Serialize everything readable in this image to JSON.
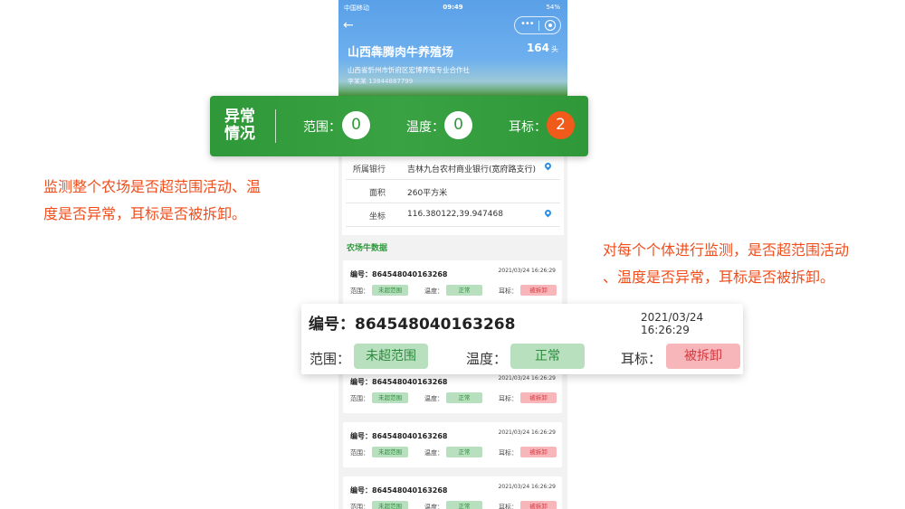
{
  "status_bar": {
    "carrier": "中国移动",
    "time": "09:49",
    "battery": "54%"
  },
  "header": {
    "farm_name": "山西犇腾肉牛养殖场",
    "head_count": "164",
    "head_unit": "头",
    "cooperative": "山西省忻州市忻府区宏博养殖专业合作社",
    "contact": "李某某   13844887799"
  },
  "abnormal": {
    "title": "异常情况",
    "range_label": "范围：",
    "range_value": "0",
    "temp_label": "温度：",
    "temp_value": "0",
    "tag_label": "耳标：",
    "tag_value": "2",
    "alert_color": "#f05a1a"
  },
  "info": [
    {
      "label": "所属银行",
      "value": "吉林九台农村商业银行(宽府路支行)",
      "icon": "location-pin-icon"
    },
    {
      "label": "面积",
      "value": "260平方米"
    },
    {
      "label": "坐标",
      "value": "116.380122,39.947468",
      "icon": "location-pin-icon"
    }
  ],
  "section_title": "农场牛数据",
  "labels": {
    "id": "编号：",
    "range": "范围：",
    "temp": "温度：",
    "tag": "耳标："
  },
  "records": [
    {
      "id": "864548040163268",
      "time": "2021/03/24 16:26:29",
      "range": "未超范围",
      "temp": "正常",
      "tag": "被拆卸"
    },
    {
      "id": "864548040163268",
      "time": "2021/03/24 16:26:29",
      "range": "未超范围",
      "temp": "正常",
      "tag": "被拆卸"
    },
    {
      "id": "864548040163268",
      "time": "2021/03/24 16:26:29",
      "range": "未超范围",
      "temp": "正常",
      "tag": "被拆卸"
    },
    {
      "id": "864548040163268",
      "time": "2021/03/24 16:26:29",
      "range": "未超范围",
      "temp": "正常",
      "tag": "被拆卸"
    },
    {
      "id": "864548040163268",
      "time": "2021/03/24 16:26:29",
      "range": "未超范围",
      "temp": "正常",
      "tag": "被拆卸"
    }
  ],
  "zoom_card": {
    "id": "编号：864548040163268",
    "time": "2021/03/24 16:26:29",
    "range": "未超范围",
    "temp": "正常",
    "tag": "被拆卸"
  },
  "notes": {
    "left_line1": "监测整个农场是否超范围活动、温",
    "left_line2": "度是否异常，耳标是否被拆卸。",
    "right_line1": "对每个个体进行监测，是否超范围活动",
    "right_line2": "、温度是否异常，耳标是否被拆卸。"
  },
  "colors": {
    "green": "#2f9838",
    "note": "#f04e1d",
    "normal_tag": "#b8e0bf",
    "alert_tag": "#f7b6b9"
  }
}
